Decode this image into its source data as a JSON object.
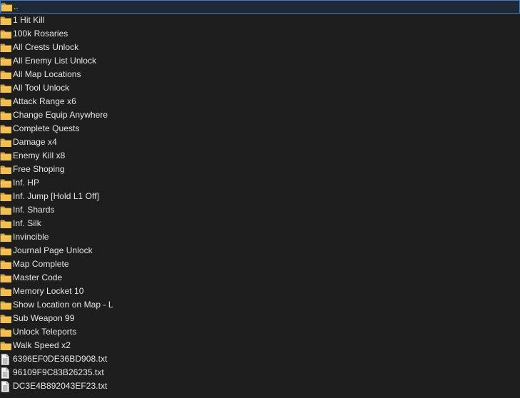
{
  "listing": {
    "items": [
      {
        "label": "..",
        "type": "folder",
        "selected": true
      },
      {
        "label": "1 Hit Kill",
        "type": "folder"
      },
      {
        "label": "100k Rosaries",
        "type": "folder"
      },
      {
        "label": "All Crests Unlock",
        "type": "folder"
      },
      {
        "label": "All Enemy List Unlock",
        "type": "folder"
      },
      {
        "label": "All Map Locations",
        "type": "folder"
      },
      {
        "label": "All Tool Unlock",
        "type": "folder"
      },
      {
        "label": "Attack Range x6",
        "type": "folder"
      },
      {
        "label": "Change Equip Anywhere",
        "type": "folder"
      },
      {
        "label": "Complete Quests",
        "type": "folder"
      },
      {
        "label": "Damage x4",
        "type": "folder"
      },
      {
        "label": "Enemy Kill x8",
        "type": "folder"
      },
      {
        "label": "Free Shoping",
        "type": "folder"
      },
      {
        "label": "Inf. HP",
        "type": "folder"
      },
      {
        "label": "Inf. Jump [Hold L1 Off]",
        "type": "folder"
      },
      {
        "label": "Inf. Shards",
        "type": "folder"
      },
      {
        "label": "Inf. Silk",
        "type": "folder"
      },
      {
        "label": "Invincible",
        "type": "folder"
      },
      {
        "label": "Journal Page Unlock",
        "type": "folder"
      },
      {
        "label": "Map Complete",
        "type": "folder"
      },
      {
        "label": "Master Code",
        "type": "folder"
      },
      {
        "label": "Memory Locket 10",
        "type": "folder"
      },
      {
        "label": "Show Location on Map - L",
        "type": "folder"
      },
      {
        "label": "Sub Weapon 99",
        "type": "folder"
      },
      {
        "label": "Unlock Teleports",
        "type": "folder"
      },
      {
        "label": "Walk Speed x2",
        "type": "folder"
      },
      {
        "label": "6396EF0DE36BD908.txt",
        "type": "file"
      },
      {
        "label": "96109F9C83B26235.txt",
        "type": "file"
      },
      {
        "label": "DC3E4B892043EF23.txt",
        "type": "file"
      }
    ]
  },
  "icons": {
    "folder": "folder-icon",
    "file": "text-file-icon"
  },
  "colors": {
    "background": "#1e1e1e",
    "text": "#e6e6e6",
    "selection_border": "#3d7fc0",
    "folder_front": "#f3c14b",
    "folder_back": "#d9a22e"
  }
}
